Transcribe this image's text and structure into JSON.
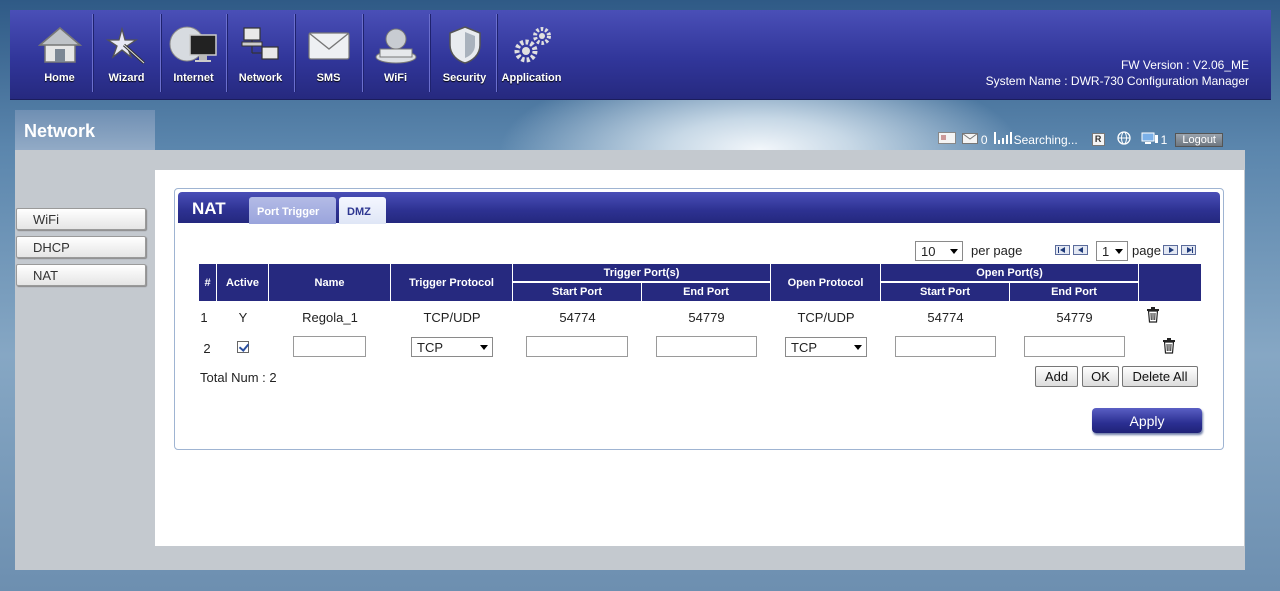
{
  "nav": {
    "items": [
      {
        "label": "Home",
        "icon": "home-icon"
      },
      {
        "label": "Wizard",
        "icon": "wizard-icon"
      },
      {
        "label": "Internet",
        "icon": "internet-icon"
      },
      {
        "label": "Network",
        "icon": "network-icon"
      },
      {
        "label": "SMS",
        "icon": "sms-icon"
      },
      {
        "label": "WiFi",
        "icon": "wifi-icon"
      },
      {
        "label": "Security",
        "icon": "security-icon"
      },
      {
        "label": "Application",
        "icon": "application-icon"
      }
    ],
    "fw_version": "FW Version : V2.06_ME",
    "system_name": "System Name : DWR-730 Configuration Manager"
  },
  "section": {
    "title": "Network"
  },
  "status": {
    "sms_count": "0",
    "signal_text": "Searching...",
    "roaming": "R",
    "clients_count": "1",
    "logout_label": "Logout"
  },
  "sidebar": {
    "items": [
      {
        "label": "WiFi"
      },
      {
        "label": "DHCP"
      },
      {
        "label": "NAT"
      }
    ]
  },
  "nat": {
    "title": "NAT",
    "tabs": [
      {
        "label": "Port Trigger",
        "active": true
      },
      {
        "label": "DMZ",
        "active": false
      }
    ],
    "per_page_value": "10",
    "per_page_label": "per page",
    "page_value": "1",
    "page_label": "page",
    "columns": {
      "num": "#",
      "active": "Active",
      "name": "Name",
      "trigger_protocol": "Trigger Protocol",
      "trigger_ports": "Trigger Port(s)",
      "open_protocol": "Open Protocol",
      "open_ports": "Open Port(s)",
      "start_port": "Start Port",
      "end_port": "End Port"
    },
    "rows": [
      {
        "num": "1",
        "active": "Y",
        "name": "Regola_1",
        "trigger_protocol": "TCP/UDP",
        "trigger_start": "54774",
        "trigger_end": "54779",
        "open_protocol": "TCP/UDP",
        "open_start": "54774",
        "open_end": "54779"
      }
    ],
    "new_row": {
      "num": "2",
      "active_checked": true,
      "name": "",
      "trigger_protocol": "TCP",
      "trigger_start": "",
      "trigger_end": "",
      "open_protocol": "TCP",
      "open_start": "",
      "open_end": ""
    },
    "total_num": "Total Num : 2",
    "buttons": {
      "add": "Add",
      "ok": "OK",
      "delete_all": "Delete All"
    },
    "apply_label": "Apply"
  },
  "colors": {
    "nav_blue": "#31369a",
    "header_dark": "#26297f",
    "tab_active": "#9aa4dc"
  }
}
